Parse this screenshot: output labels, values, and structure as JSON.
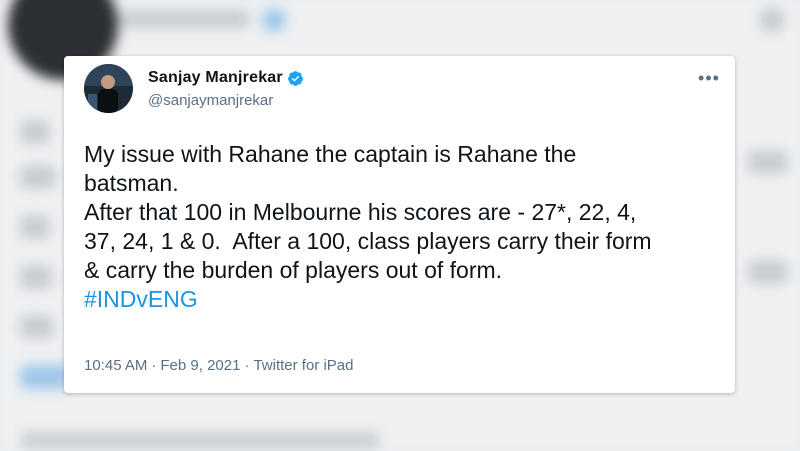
{
  "tweet": {
    "display_name": "Sanjay Manjrekar",
    "handle": "@sanjaymanjrekar",
    "text_lines": [
      "My issue with Rahane the captain is Rahane the",
      "batsman.",
      "After that 100 in Melbourne his scores are - 27*, 22, 4,",
      "37, 24, 1 & 0.  After a 100, class players carry their form",
      "& carry the burden of players out of form."
    ],
    "hashtag": "#INDvENG",
    "time": "10:45 AM",
    "date": "Feb 9, 2021",
    "source": "Twitter for iPad",
    "separator": "·",
    "more_glyph": "•••"
  },
  "colors": {
    "accent": "#1b95e0",
    "verified": "#1da1f2",
    "text": "#0f1419",
    "muted": "#5b7083"
  },
  "icons": {
    "verified": "verified-badge-icon",
    "more": "more-options-icon"
  }
}
